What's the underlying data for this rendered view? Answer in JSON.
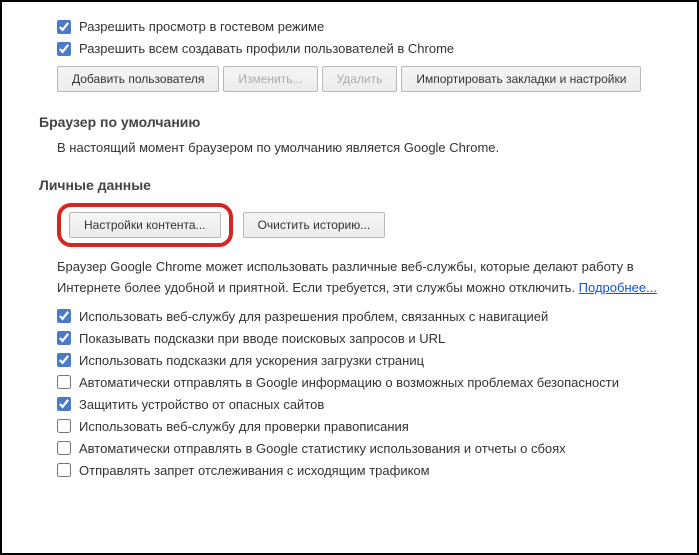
{
  "topSection": {
    "checkbox1": {
      "label": "Разрешить просмотр в гостевом режиме",
      "checked": true
    },
    "checkbox2": {
      "label": "Разрешить всем создавать профили пользователей в Chrome",
      "checked": true
    },
    "buttons": {
      "addUser": "Добавить пользователя",
      "edit": "Изменить...",
      "delete": "Удалить",
      "import": "Импортировать закладки и настройки"
    }
  },
  "defaultBrowser": {
    "heading": "Браузер по умолчанию",
    "text": "В настоящий момент браузером по умолчанию является Google Chrome."
  },
  "personalData": {
    "heading": "Личные данные",
    "buttons": {
      "contentSettings": "Настройки контента...",
      "clearHistory": "Очистить историю..."
    },
    "infoText": "Браузер Google Chrome может использовать различные веб-службы, которые делают работу в Интернете более удобной и приятной. Если требуется, эти службы можно отключить. ",
    "moreLink": "Подробнее...",
    "options": {
      "opt1": {
        "label": "Использовать веб-службу для разрешения проблем, связанных с навигацией",
        "checked": true
      },
      "opt2": {
        "label": "Показывать подсказки при вводе поисковых запросов и URL",
        "checked": true
      },
      "opt3": {
        "label": "Использовать подсказки для ускорения загрузки страниц",
        "checked": true
      },
      "opt4": {
        "label": "Автоматически отправлять в Google информацию о возможных проблемах безопасности",
        "checked": false
      },
      "opt5": {
        "label": "Защитить устройство от опасных сайтов",
        "checked": true
      },
      "opt6": {
        "label": "Использовать веб-службу для проверки правописания",
        "checked": false
      },
      "opt7": {
        "label": "Автоматически отправлять в Google статистику использования и отчеты о сбоях",
        "checked": false
      },
      "opt8": {
        "label": "Отправлять запрет отслеживания с исходящим трафиком",
        "checked": false
      }
    }
  }
}
